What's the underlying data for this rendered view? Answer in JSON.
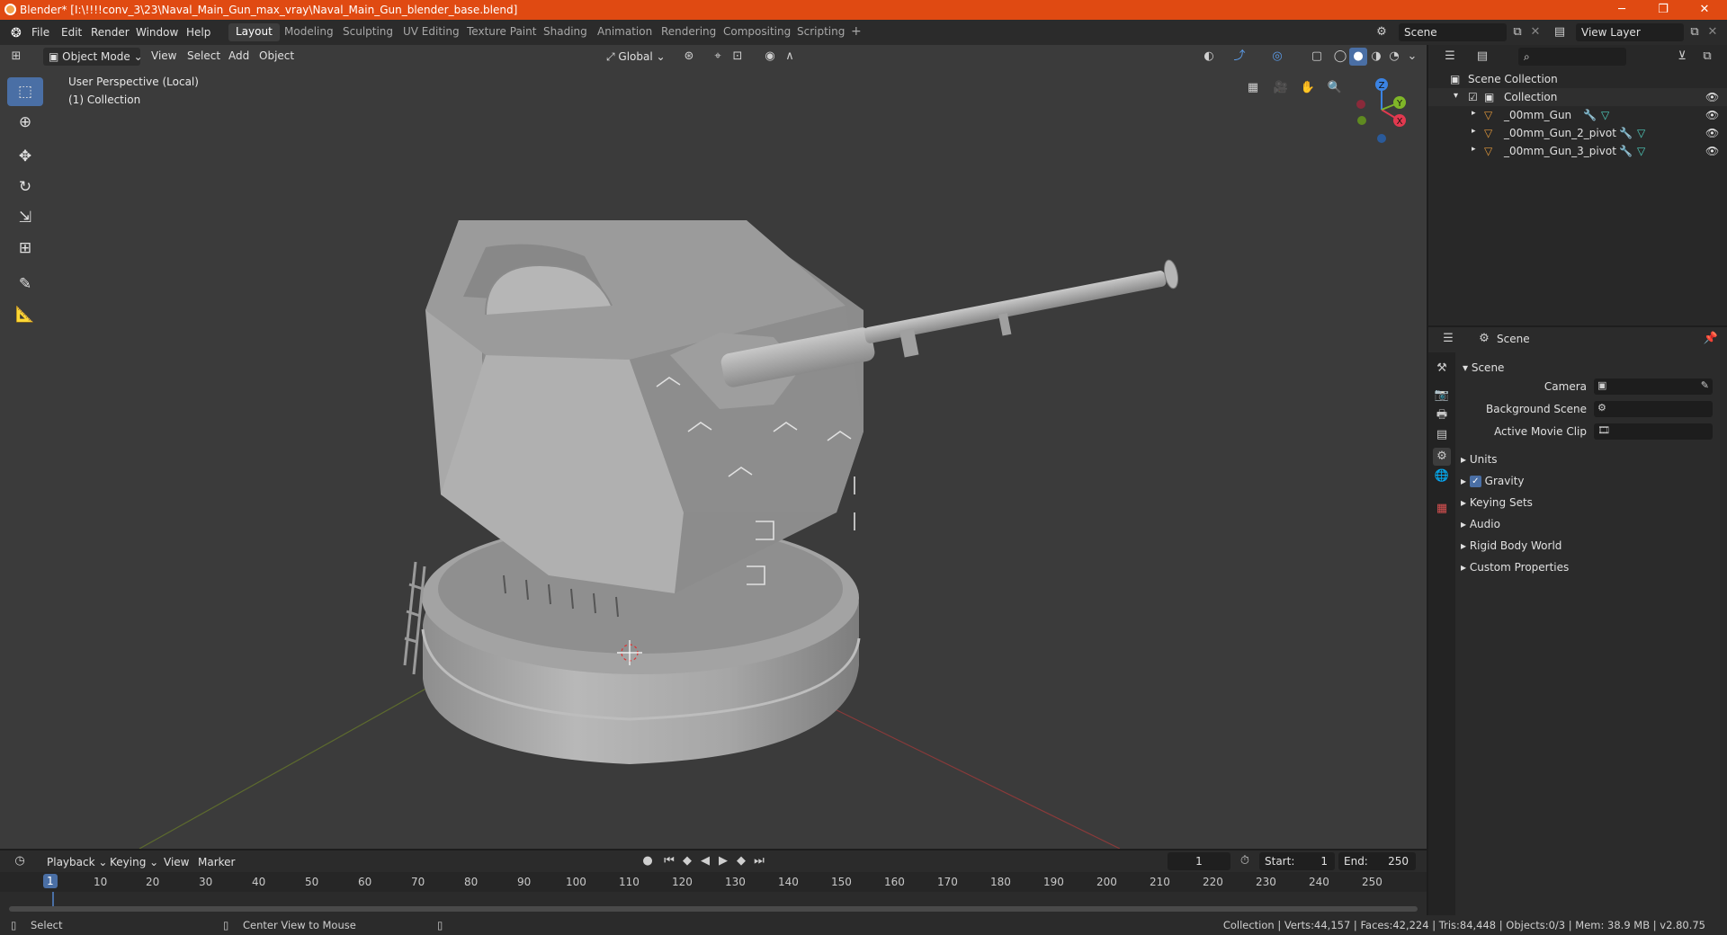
{
  "window": {
    "title": "Blender* [I:\\!!!!conv_3\\23\\Naval_Main_Gun_max_vray\\Naval_Main_Gun_blender_base.blend]",
    "minimize": "─",
    "restore": "❐",
    "close": "✕"
  },
  "menubar": {
    "items": [
      "File",
      "Edit",
      "Render",
      "Window",
      "Help"
    ],
    "workspaces": [
      "Layout",
      "Modeling",
      "Sculpting",
      "UV Editing",
      "Texture Paint",
      "Shading",
      "Animation",
      "Rendering",
      "Compositing",
      "Scripting"
    ],
    "add_workspace": "+",
    "scene": "Scene",
    "view_layer": "View Layer"
  },
  "viewport": {
    "mode": "Object Mode",
    "menus": [
      "View",
      "Select",
      "Add",
      "Object"
    ],
    "orientation": "Global",
    "perspective_label": "User Perspective (Local)",
    "collection_label": "(1) Collection",
    "gizmo_axes": {
      "x": "X",
      "y": "Y",
      "z": "Z"
    }
  },
  "outliner": {
    "root": "Scene Collection",
    "collection": "Collection",
    "objects": [
      "_00mm_Gun",
      "_00mm_Gun_2_pivot",
      "_00mm_Gun_3_pivot"
    ]
  },
  "properties": {
    "context": "Scene",
    "panel_title": "Scene",
    "camera_label": "Camera",
    "background_scene_label": "Background Scene",
    "active_movie_clip_label": "Active Movie Clip",
    "sections": [
      "Units",
      "Gravity",
      "Keying Sets",
      "Audio",
      "Rigid Body World",
      "Custom Properties"
    ],
    "gravity_checked": true
  },
  "timeline": {
    "menus": [
      "Playback",
      "Keying",
      "View",
      "Marker"
    ],
    "current_frame": "1",
    "start_label": "Start:",
    "start": "1",
    "end_label": "End:",
    "end": "250",
    "ticks": [
      "1",
      "10",
      "20",
      "30",
      "40",
      "50",
      "60",
      "70",
      "80",
      "90",
      "100",
      "110",
      "120",
      "130",
      "140",
      "150",
      "160",
      "170",
      "180",
      "190",
      "200",
      "210",
      "220",
      "230",
      "240",
      "250"
    ]
  },
  "statusbar": {
    "select": "Select",
    "center_view": "Center View to Mouse",
    "stats": "Collection | Verts:44,157 | Faces:42,224 | Tris:84,448 | Objects:0/3 | Mem: 38.9 MB | v2.80.75"
  },
  "colors": {
    "titlebar": "#e04a12",
    "accent": "#4a6fa5",
    "viewport_bg": "#3b3b3b",
    "axis_x": "#e2394f",
    "axis_y": "#7fb628",
    "axis_z": "#3b83e3"
  }
}
